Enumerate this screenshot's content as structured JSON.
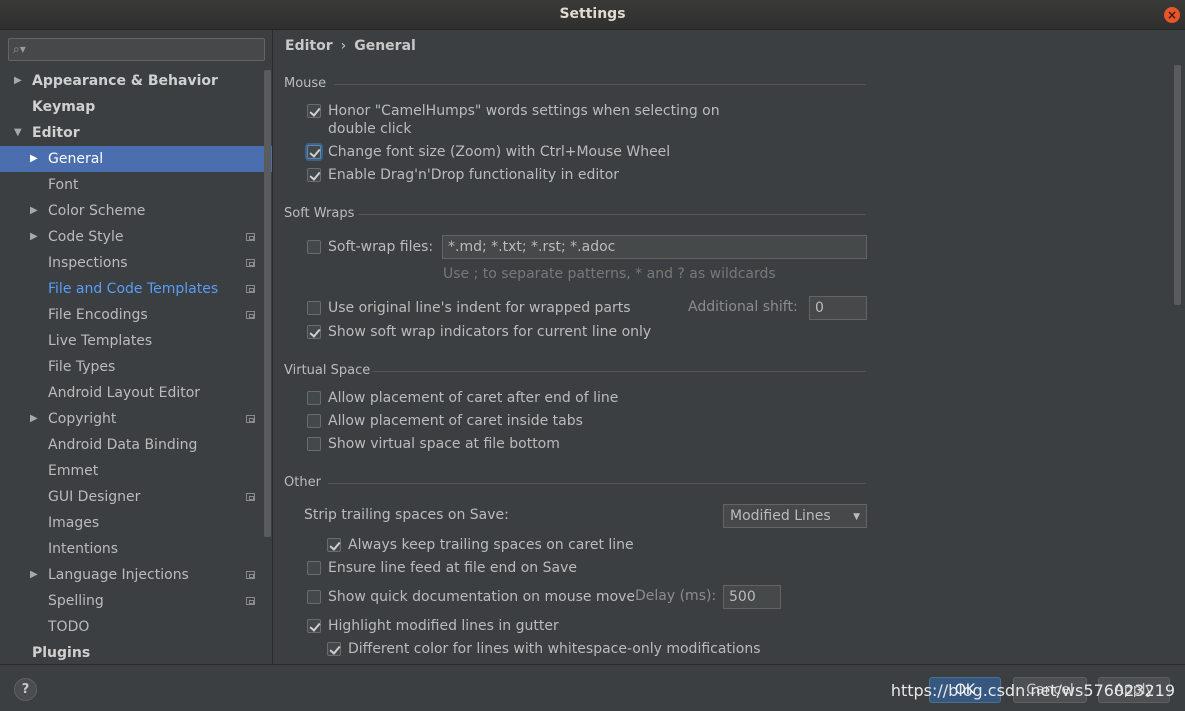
{
  "window": {
    "title": "Settings",
    "close": "×"
  },
  "search": {
    "placeholder": "",
    "icon": "search-icon"
  },
  "tree": [
    {
      "label": "Appearance & Behavior",
      "level": 0,
      "arrow": "▶",
      "bold": true
    },
    {
      "label": "Keymap",
      "level": 0,
      "arrow": "",
      "bold": true
    },
    {
      "label": "Editor",
      "level": 0,
      "arrow": "▼",
      "bold": true
    },
    {
      "label": "General",
      "level": 1,
      "arrow": "▶",
      "selected": true
    },
    {
      "label": "Font",
      "level": 1,
      "arrow": ""
    },
    {
      "label": "Color Scheme",
      "level": 1,
      "arrow": "▶"
    },
    {
      "label": "Code Style",
      "level": 1,
      "arrow": "▶",
      "project": true
    },
    {
      "label": "Inspections",
      "level": 1,
      "arrow": "",
      "project": true
    },
    {
      "label": "File and Code Templates",
      "level": 1,
      "arrow": "",
      "project": true,
      "link": true
    },
    {
      "label": "File Encodings",
      "level": 1,
      "arrow": "",
      "project": true
    },
    {
      "label": "Live Templates",
      "level": 1,
      "arrow": ""
    },
    {
      "label": "File Types",
      "level": 1,
      "arrow": ""
    },
    {
      "label": "Android Layout Editor",
      "level": 1,
      "arrow": ""
    },
    {
      "label": "Copyright",
      "level": 1,
      "arrow": "▶",
      "project": true
    },
    {
      "label": "Android Data Binding",
      "level": 1,
      "arrow": ""
    },
    {
      "label": "Emmet",
      "level": 1,
      "arrow": ""
    },
    {
      "label": "GUI Designer",
      "level": 1,
      "arrow": "",
      "project": true
    },
    {
      "label": "Images",
      "level": 1,
      "arrow": ""
    },
    {
      "label": "Intentions",
      "level": 1,
      "arrow": ""
    },
    {
      "label": "Language Injections",
      "level": 1,
      "arrow": "▶",
      "project": true
    },
    {
      "label": "Spelling",
      "level": 1,
      "arrow": "",
      "project": true
    },
    {
      "label": "TODO",
      "level": 1,
      "arrow": ""
    },
    {
      "label": "Plugins",
      "level": 0,
      "arrow": "",
      "bold": true
    }
  ],
  "breadcrumb": {
    "parent": "Editor",
    "sep": "›",
    "current": "General"
  },
  "sections": {
    "mouse": "Mouse",
    "soft_wraps": "Soft Wraps",
    "virtual_space": "Virtual Space",
    "other": "Other"
  },
  "mouse": {
    "camelhumps_line1": "Honor \"CamelHumps\" words settings when selecting on",
    "camelhumps_line2": "double click",
    "zoom": "Change font size (Zoom) with Ctrl+Mouse Wheel",
    "dragdrop": "Enable Drag'n'Drop functionality in editor"
  },
  "soft_wraps": {
    "files_label": "Soft-wrap files:",
    "files_value": "*.md; *.txt; *.rst; *.adoc",
    "hint": "Use ; to separate patterns, * and ? as wildcards",
    "original_indent": "Use original line's indent for wrapped parts",
    "additional_shift_label": "Additional shift:",
    "additional_shift_value": "0",
    "indicators": "Show soft wrap indicators for current line only"
  },
  "virtual_space": {
    "after_eol": "Allow placement of caret after end of line",
    "inside_tabs": "Allow placement of caret inside tabs",
    "file_bottom": "Show virtual space at file bottom"
  },
  "other": {
    "strip_label": "Strip trailing spaces on Save:",
    "strip_value": "Modified Lines",
    "keep_caret": "Always keep trailing spaces on caret line",
    "line_feed": "Ensure line feed at file end on Save",
    "quick_doc": "Show quick documentation on mouse move",
    "delay_label": "Delay (ms):",
    "delay_value": "500",
    "highlight": "Highlight modified lines in gutter",
    "whitespace_color": "Different color for lines with whitespace-only modifications"
  },
  "footer": {
    "help": "?",
    "ok": "OK",
    "cancel": "Cancel",
    "apply": "Apply",
    "watermark": "https://blog.csdn.net/ws576023219"
  },
  "colors": {
    "accent": "#4b6eaf",
    "link": "#589df6",
    "bg": "#3c3f41",
    "close": "#e9562b"
  }
}
